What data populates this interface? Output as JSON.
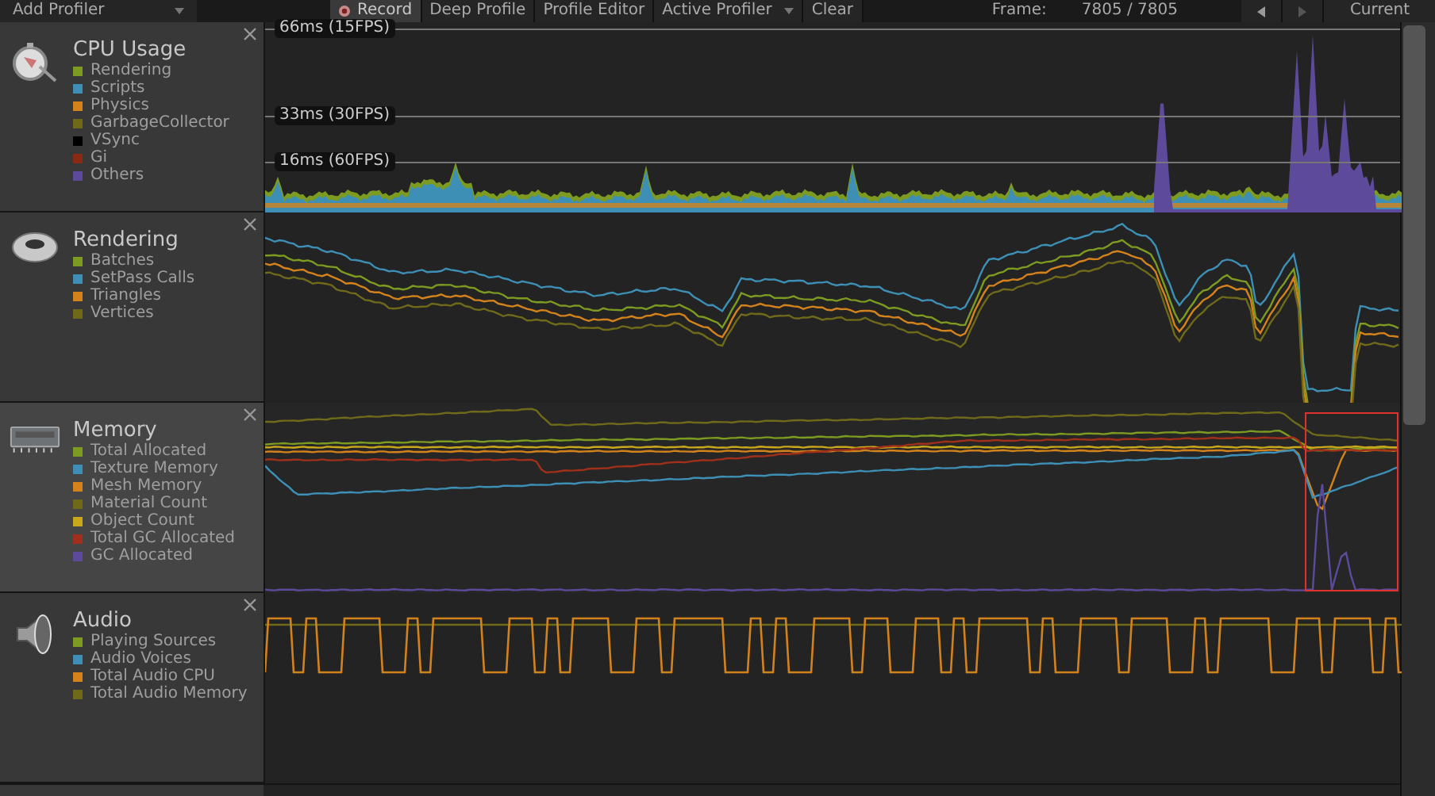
{
  "toolbar": {
    "add_profiler": "Add Profiler",
    "buttons": [
      {
        "label": "Record",
        "kind": "record",
        "on": true
      },
      {
        "label": "Deep Profile",
        "kind": "toggle",
        "on": false
      },
      {
        "label": "Profile Editor",
        "kind": "toggle",
        "on": false
      },
      {
        "label": "Active Profiler",
        "kind": "dropdown"
      },
      {
        "label": "Clear",
        "kind": "button"
      }
    ],
    "frame_label": "Frame:",
    "frame_value": "7805 / 7805",
    "current": "Current"
  },
  "modules": [
    {
      "kind": "cpu",
      "title": "CPU Usage",
      "selected": false,
      "guides": [
        "66ms (15FPS)",
        "33ms (30FPS)",
        "16ms (60FPS)"
      ],
      "legend": [
        {
          "label": "Rendering",
          "color": "#7d9b20"
        },
        {
          "label": "Scripts",
          "color": "#3d8fb5"
        },
        {
          "label": "Physics",
          "color": "#d3821c"
        },
        {
          "label": "GarbageCollector",
          "color": "#6f6a1a"
        },
        {
          "label": "VSync",
          "color": "#000000"
        },
        {
          "label": "Gi",
          "color": "#8b2a12"
        },
        {
          "label": "Others",
          "color": "#5d4a9a"
        }
      ]
    },
    {
      "kind": "rendering",
      "title": "Rendering",
      "selected": false,
      "legend": [
        {
          "label": "Batches",
          "color": "#7d9b20"
        },
        {
          "label": "SetPass Calls",
          "color": "#3d8fb5"
        },
        {
          "label": "Triangles",
          "color": "#d3821c"
        },
        {
          "label": "Vertices",
          "color": "#6f6a1a"
        }
      ]
    },
    {
      "kind": "memory",
      "title": "Memory",
      "selected": true,
      "legend": [
        {
          "label": "Total Allocated",
          "color": "#7d9b20"
        },
        {
          "label": "Texture Memory",
          "color": "#3d8fb5"
        },
        {
          "label": "Mesh Memory",
          "color": "#d3821c"
        },
        {
          "label": "Material Count",
          "color": "#6f6a1a"
        },
        {
          "label": "Object Count",
          "color": "#c9a81c"
        },
        {
          "label": "Total GC Allocated",
          "color": "#a0301a"
        },
        {
          "label": "GC Allocated",
          "color": "#5d4a9a"
        }
      ]
    },
    {
      "kind": "audio",
      "title": "Audio",
      "selected": false,
      "legend": [
        {
          "label": "Playing Sources",
          "color": "#7d9b20"
        },
        {
          "label": "Audio Voices",
          "color": "#3d8fb5"
        },
        {
          "label": "Total Audio CPU",
          "color": "#d3821c"
        },
        {
          "label": "Total Audio Memory",
          "color": "#6f6a1a"
        }
      ]
    }
  ]
}
